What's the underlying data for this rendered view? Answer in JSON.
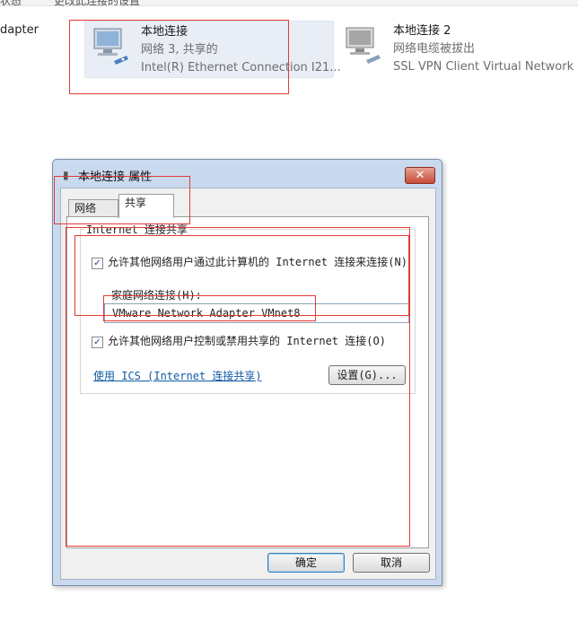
{
  "topbar": {
    "left_text": "状态",
    "mid_text": "更改此连接的设置"
  },
  "left_fragment": "dapter",
  "connections": [
    {
      "name": "本地连接",
      "status": "网络  3, 共享的",
      "device": "Intel(R) Ethernet Connection I21..."
    },
    {
      "name": "本地连接 2",
      "status": "网络电缆被拔出",
      "device": "SSL VPN Client Virtual Network ..."
    }
  ],
  "dialog": {
    "title": "本地连接 属性",
    "close_label": "✕",
    "tabs": [
      "网络",
      "共享"
    ],
    "group_label": "Internet 连接共享",
    "option1": "允许其他网络用户通过此计算机的 Internet 连接来连接(N)",
    "home_label": "家庭网络连接(H):",
    "home_value": "VMware Network Adapter VMnet8",
    "option2": "允许其他网络用户控制或禁用共享的 Internet 连接(O)",
    "link": "使用 ICS (Internet 连接共享)",
    "settings_button": "设置(G)...",
    "ok_button": "确定",
    "cancel_button": "取消",
    "checked_mark": "✓"
  },
  "colors": {
    "highlight_red": "#e53935",
    "accent_blue": "#0f5aa6"
  }
}
